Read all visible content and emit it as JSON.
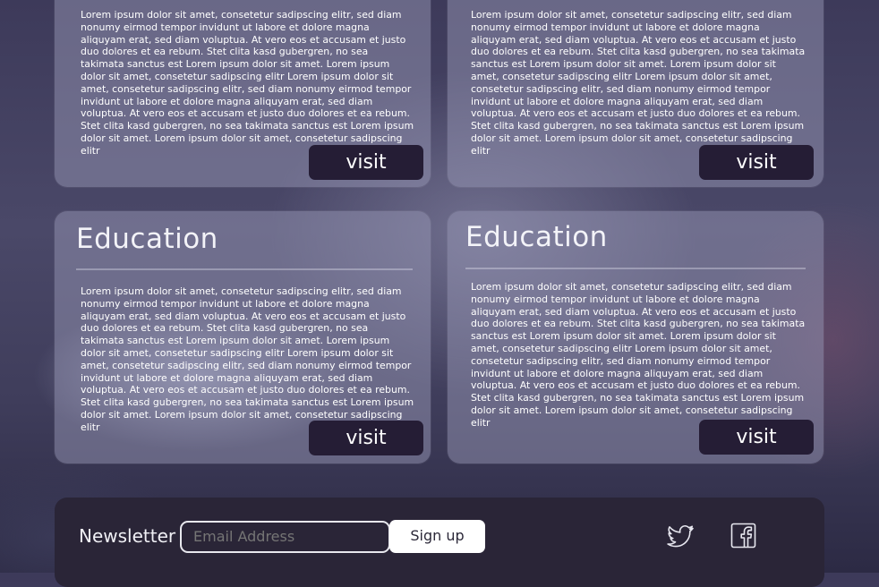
{
  "cards": [
    {
      "title": "",
      "body": "Lorem ipsum dolor sit amet, consetetur sadipscing elitr, sed diam nonumy eirmod tempor invidunt ut labore et dolore magna aliquyam erat, sed diam voluptua. At vero eos et accusam et justo duo dolores et ea rebum. Stet clita kasd gubergren, no sea takimata sanctus est Lorem ipsum dolor sit amet. Lorem ipsum dolor sit amet, consetetur sadipscing elitr Lorem ipsum dolor sit amet, consetetur sadipscing elitr, sed diam nonumy eirmod tempor invidunt ut labore et dolore magna aliquyam erat, sed diam voluptua. At vero eos et accusam et justo duo dolores et ea rebum. Stet clita kasd gubergren, no sea takimata sanctus est Lorem ipsum dolor sit amet. Lorem ipsum dolor sit amet, consetetur sadipscing elitr",
      "button": "visit"
    },
    {
      "title": "",
      "body": "Lorem ipsum dolor sit amet, consetetur sadipscing elitr, sed diam nonumy eirmod tempor invidunt ut labore et dolore magna aliquyam erat, sed diam voluptua. At vero eos et accusam et justo duo dolores et ea rebum. Stet clita kasd gubergren, no sea takimata sanctus est Lorem ipsum dolor sit amet. Lorem ipsum dolor sit amet, consetetur sadipscing elitr Lorem ipsum dolor sit amet, consetetur sadipscing elitr, sed diam nonumy eirmod tempor invidunt ut labore et dolore magna aliquyam erat, sed diam voluptua. At vero eos et accusam et justo duo dolores et ea rebum. Stet clita kasd gubergren, no sea takimata sanctus est Lorem ipsum dolor sit amet. Lorem ipsum dolor sit amet, consetetur sadipscing elitr",
      "button": "visit"
    },
    {
      "title": "Education",
      "body": "Lorem ipsum dolor sit amet, consetetur sadipscing elitr, sed diam nonumy eirmod tempor invidunt ut labore et dolore magna aliquyam erat, sed diam voluptua. At vero eos et accusam et justo duo dolores et ea rebum. Stet clita kasd gubergren, no sea takimata sanctus est Lorem ipsum dolor sit amet. Lorem ipsum dolor sit amet, consetetur sadipscing elitr Lorem ipsum dolor sit amet, consetetur sadipscing elitr, sed diam nonumy eirmod tempor invidunt ut labore et dolore magna aliquyam erat, sed diam voluptua. At vero eos et accusam et justo duo dolores et ea rebum. Stet clita kasd gubergren, no sea takimata sanctus est Lorem ipsum dolor sit amet. Lorem ipsum dolor sit amet, consetetur sadipscing elitr",
      "button": "visit"
    },
    {
      "title": "Education",
      "body": "Lorem ipsum dolor sit amet, consetetur sadipscing elitr, sed diam nonumy eirmod tempor invidunt ut labore et dolore magna aliquyam erat, sed diam voluptua. At vero eos et accusam et justo duo dolores et ea rebum. Stet clita kasd gubergren, no sea takimata sanctus est Lorem ipsum dolor sit amet. Lorem ipsum dolor sit amet, consetetur sadipscing elitr Lorem ipsum dolor sit amet, consetetur sadipscing elitr, sed diam nonumy eirmod tempor invidunt ut labore et dolore magna aliquyam erat, sed diam voluptua. At vero eos et accusam et justo duo dolores et ea rebum. Stet clita kasd gubergren, no sea takimata sanctus est Lorem ipsum dolor sit amet. Lorem ipsum dolor sit amet, consetetur sadipscing elitr",
      "button": "visit"
    }
  ],
  "newsletter": {
    "label": "Newsletter",
    "email_placeholder": "Email Address",
    "signup_label": "Sign up"
  },
  "social": {
    "twitter_icon": "twitter-icon",
    "facebook_icon": "facebook-icon"
  },
  "colors": {
    "button_bg": "#251d35",
    "footer_bg": "#2a2537",
    "card_bg": "rgba(150,150,180,0.50)"
  }
}
